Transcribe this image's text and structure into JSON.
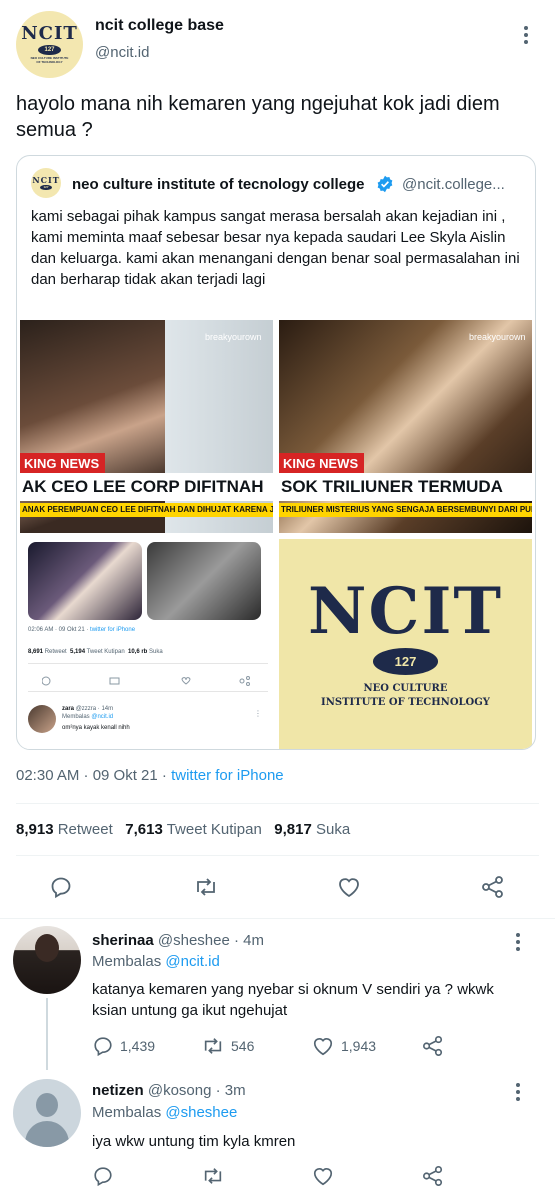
{
  "main_tweet": {
    "display_name": "ncit college base",
    "handle": "@ncit.id",
    "text": "hayolo mana nih kemaren yang ngejuhat kok jadi diem semua ?",
    "timestamp": "02:30 AM · 09 Okt 21 · ",
    "source": "twitter for iPhone",
    "retweets": "8,913",
    "retweets_label": "Retweet",
    "quotes": "7,613",
    "quotes_label": "Tweet Kutipan",
    "likes": "9,817",
    "likes_label": "Suka"
  },
  "avatar_logo": {
    "word": "NCIT",
    "number": "127",
    "sub": "NEO CULTURE INSTITUTE OF TECHNOLOGY"
  },
  "quoted_tweet": {
    "display_name": "neo culture institute of tecnology college",
    "handle": "@ncit.college...",
    "verified": true,
    "text": "kami sebagai pihak kampus sangat merasa bersalah akan kejadian ini , kami meminta maaf sebesar besar nya kepada saudari Lee Skyla Aislin dan keluarga. kami akan menangani dengan benar soal permasalahan ini dan berharap tidak akan terjadi lagi"
  },
  "media": {
    "left_news": {
      "watermark": "",
      "breaking": "KING NEWS",
      "headline": "AK CEO LEE CORP DIFITNAH",
      "ticker": "ANAK PEREMPUAN CEO LEE DIFITNAH DAN DIHUJAT KARENA JALAN I"
    },
    "right_news": {
      "watermark": "breakyourown",
      "breaking": "KING NEWS",
      "headline": "SOK TRILIUNER TERMUDA",
      "ticker": "TRILIUNER MISTERIUS YANG SENGAJA BERSEMBUNYI DARI PUBLIK AI"
    },
    "left_news_watermark": "breakyourown",
    "embedded": {
      "timestamp": "02:06 AM · 09 Okt 21 · ",
      "source": "twitter for iPhone",
      "retweets": "8,691",
      "retweets_label": "Retweet",
      "quotes": "5,194",
      "quotes_label": "Tweet Kutipan",
      "likes": "10,6 rb",
      "likes_label": "Suka",
      "reply_name": "zara",
      "reply_handle": "@zzzra · 14m",
      "reply_to_label": "Membalas",
      "reply_to": "@ncit.id",
      "reply_text": "om²nya kayak kenall nihh"
    },
    "big_logo": {
      "word": "NCIT",
      "number": "127",
      "line1": "NEO CULTURE",
      "line2": "INSTITUTE OF TECHNOLOGY"
    }
  },
  "replies": [
    {
      "display_name": "sherinaa",
      "handle": "@sheshee",
      "time": "· 4m",
      "reply_to_label": "Membalas",
      "reply_to": "@ncit.id",
      "text": "katanya kemaren yang nyebar si oknum V sendiri ya ? wkwk ksian untung ga ikut ngehujat",
      "replies_count": "1,439",
      "retweets": "546",
      "likes": "1,943"
    },
    {
      "display_name": "netizen",
      "handle": "@kosong",
      "time": "· 3m",
      "reply_to_label": "Membalas",
      "reply_to": "@sheshee",
      "text": "iya wkw untung tim kyla kmren"
    }
  ],
  "colors": {
    "link": "#1d9bf0",
    "muted": "#536471",
    "logo_bg": "#f3e7b0",
    "logo_navy": "#1e2a4a",
    "breaking_red": "#d62424",
    "ticker_yellow": "#ffd400"
  }
}
